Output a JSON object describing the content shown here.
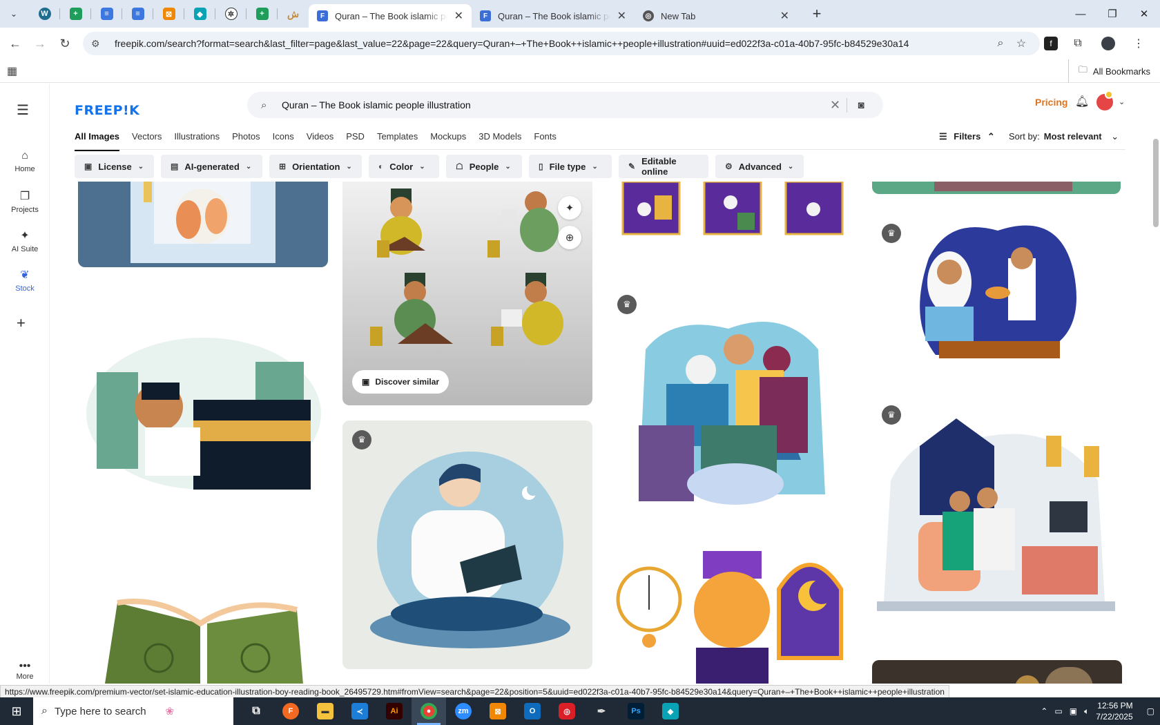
{
  "browser": {
    "tabs": [
      {
        "title": "Quran – The Book islamic people illustration",
        "active": true
      },
      {
        "title": "Quran – The Book islamic people illustration",
        "active": false
      },
      {
        "title": "New Tab",
        "active": false
      }
    ],
    "pinned_icons": [
      "wordpress-icon",
      "sheets-icon",
      "docs-icon",
      "docs-icon",
      "drawio-icon",
      "azure-icon",
      "chatgpt-icon",
      "sheets-icon",
      "arabic-logo-icon"
    ],
    "url": "freepik.com/search?format=search&last_filter=page&last_value=22&page=22&query=Quran+–+The+Book++islamic++people+illustration#uuid=ed022f3a-c01a-40b7-95fc-b84529e30a14",
    "bookmarks_label": "All Bookmarks",
    "status_url": "https://www.freepik.com/premium-vector/set-islamic-education-illustration-boy-reading-book_26495729.htm#fromView=search&page=22&position=5&uuid=ed022f3a-c01a-40b7-95fc-b84529e30a14&query=Quran+–+The+Book++islamic++people+illustration"
  },
  "sidebar": {
    "items": [
      {
        "label": "Home",
        "icon": "home-icon"
      },
      {
        "label": "Projects",
        "icon": "projects-icon"
      },
      {
        "label": "AI Suite",
        "icon": "sparkle-icon"
      },
      {
        "label": "Stock",
        "icon": "stock-icon"
      }
    ],
    "more_label": "More"
  },
  "header": {
    "logo": "FREEP!K",
    "search_value": "Quran – The Book  islamic  people illustration",
    "pricing": "Pricing"
  },
  "categories": [
    "All Images",
    "Vectors",
    "Illustrations",
    "Photos",
    "Icons",
    "Videos",
    "PSD",
    "Templates",
    "Mockups",
    "3D Models",
    "Fonts"
  ],
  "filters_label": "Filters",
  "sort": {
    "label": "Sort by:",
    "value": "Most relevant"
  },
  "chips": [
    {
      "label": "License",
      "icon": "license-icon"
    },
    {
      "label": "AI-generated",
      "icon": "ai-icon"
    },
    {
      "label": "Orientation",
      "icon": "orientation-icon"
    },
    {
      "label": "Color",
      "icon": "palette-icon"
    },
    {
      "label": "People",
      "icon": "people-icon"
    },
    {
      "label": "File type",
      "icon": "file-icon"
    },
    {
      "label": "Editable online",
      "icon": "pen-icon"
    },
    {
      "label": "Advanced",
      "icon": "gear-icon"
    }
  ],
  "discover_label": "Discover similar",
  "taskbar": {
    "search_placeholder": "Type here to search",
    "time": "12:56 PM",
    "date": "7/22/2025"
  }
}
